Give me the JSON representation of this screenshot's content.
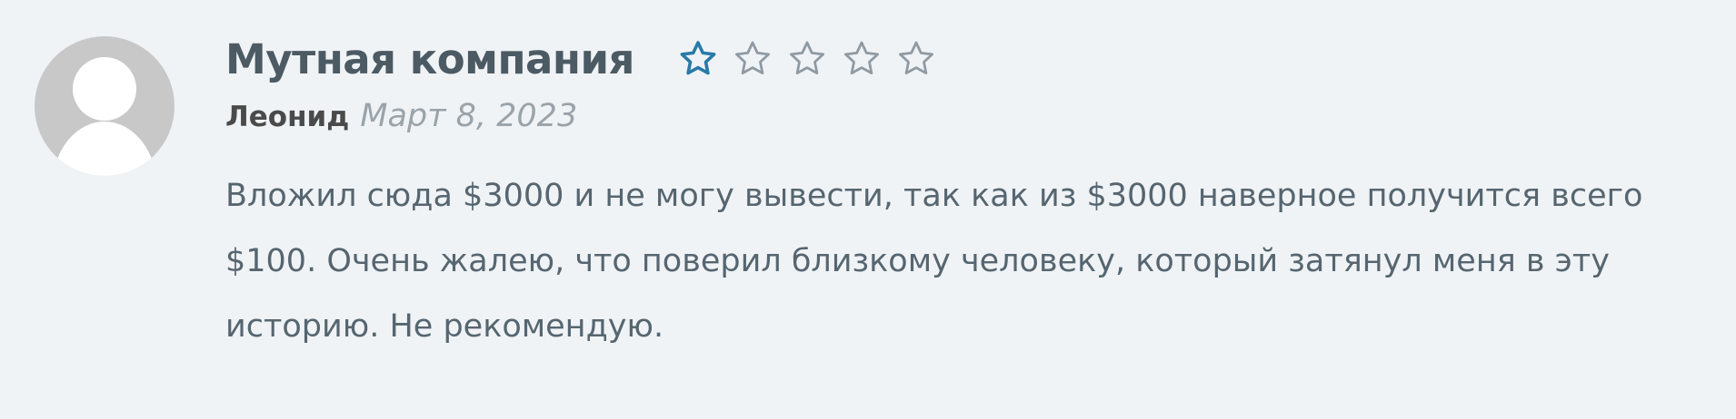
{
  "review": {
    "title": "Мутная компания",
    "rating": 1,
    "rating_max": 5,
    "author": "Леонид",
    "date": "Март 8, 2023",
    "body_lines": [
      "Вложил сюда $3000 и не могу вывести, так как из $3000 наверное получится всего",
      "$100. Очень жалею, что поверил близкому человеку, который затянул меня в эту",
      "историю. Не рекомендую."
    ]
  },
  "colors": {
    "background": "#f0f3f6",
    "title": "#4c5a63",
    "star_filled": "#2a7aa8",
    "star_empty": "#8f9aa3",
    "author": "#4a4a4a",
    "date": "#9aa3aa",
    "body": "#566670",
    "avatar_bg": "#c8c8c8",
    "avatar_fg": "#ffffff"
  },
  "icons": {
    "avatar": "user-placeholder-icon",
    "star": "star-outline-icon"
  }
}
